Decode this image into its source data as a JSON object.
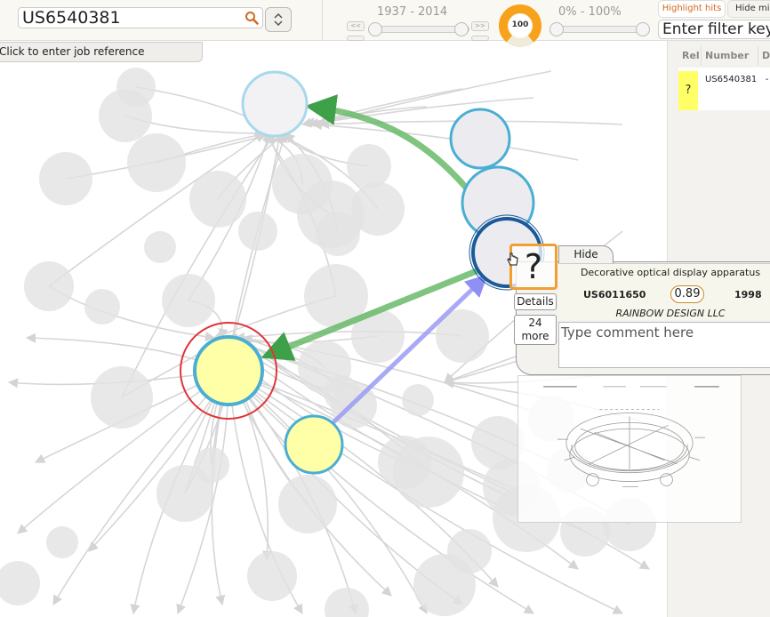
{
  "toolbar": {
    "search_value": "US6540381",
    "year_range": "1937 - 2014",
    "gauge_value": "100",
    "gauge_fraction": 0.78,
    "percent_range": "0% - 100%",
    "highlight_label": "Highlight hits",
    "hide_missing_label": "Hide miss",
    "filter_placeholder": "Enter filter key",
    "scroll_left_label": "<<",
    "scroll_right_label": ">>"
  },
  "job_reference": "Click to enter job reference",
  "results": {
    "columns": [
      "Rel",
      "Number",
      "D"
    ],
    "rows": [
      {
        "rel": "?",
        "number": "US6540381",
        "extra": "-"
      }
    ]
  },
  "popup": {
    "hide_label": "Hide",
    "unknown_mark": "?",
    "details_label": "Details",
    "more_count": "24",
    "more_label": "more",
    "title": "Decorative optical display apparatus",
    "number": "US6011650",
    "score": "0.89",
    "year": "1998",
    "assignee": "RAINBOW DESIGN LLC",
    "comment_placeholder": "Type comment here"
  },
  "colors": {
    "node_blue": "#4aaed3",
    "node_blue_light": "#a8d8ec",
    "node_dark_blue": "#1a5a9a",
    "node_yellow": "#ffffa8",
    "target_red": "#e0353a",
    "edge_green": "#5fb55f",
    "edge_purple": "#9a9af5",
    "score_orange": "#f0a030"
  },
  "icons": {
    "search": "search-icon",
    "sort": "sort-arrows-icon",
    "cursor": "hand-cursor-icon"
  }
}
